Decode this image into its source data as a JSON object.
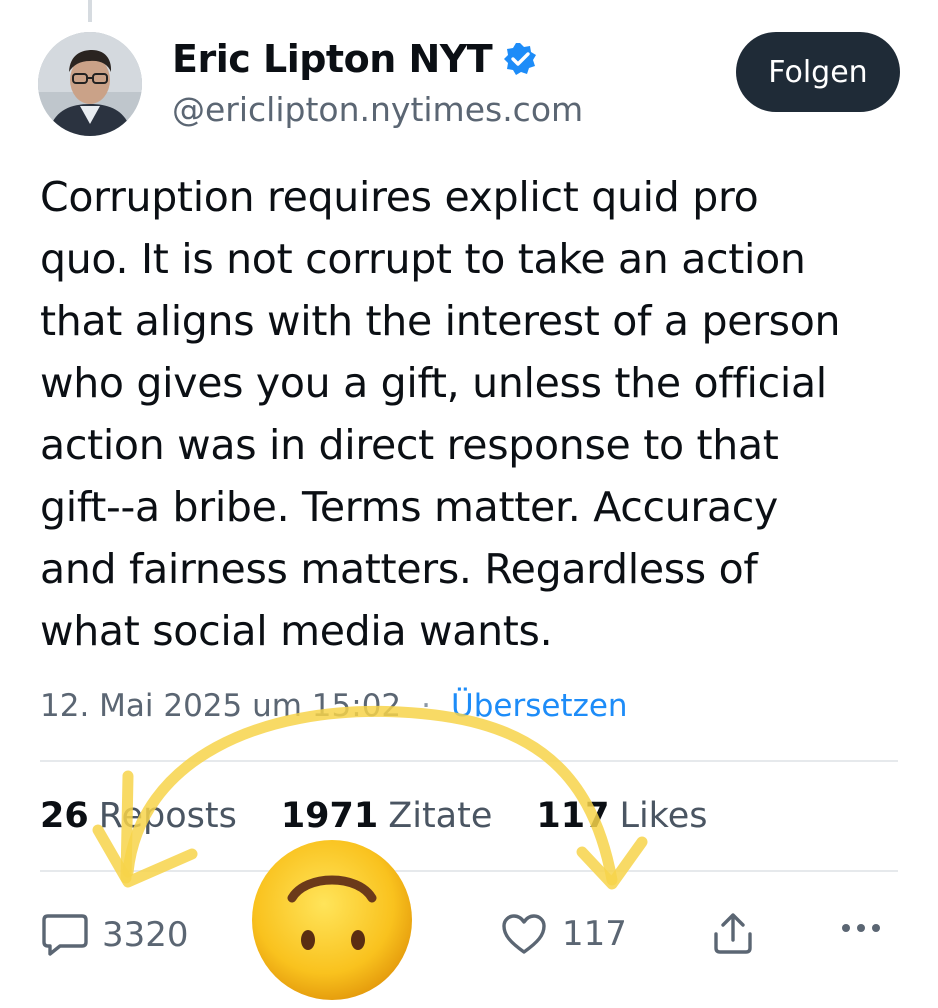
{
  "post": {
    "author": {
      "display_name": "Eric Lipton NYT",
      "handle": "@ericlipton.nytimes.com",
      "verified": true
    },
    "follow_label": "Folgen",
    "text_lines": [
      "Corruption requires explict quid pro",
      "quo. It is not corrupt to take an action",
      "that aligns with the interest of a person",
      "who gives you a gift, unless the official",
      "action was in direct response to that",
      "gift--a bribe. Terms matter. Accuracy",
      "and fairness matters. Regardless of",
      "what social media wants."
    ],
    "timestamp": "12. Mai 2025 um 15:02",
    "separator": "·",
    "translate_label": "Übersetzen",
    "stats": [
      {
        "count": "26",
        "label": "Reposts"
      },
      {
        "count": "1971",
        "label": "Zitate"
      },
      {
        "count": "117",
        "label": "Likes"
      }
    ],
    "actions": {
      "reply_count": "3320",
      "like_count": "117"
    }
  },
  "icons": {
    "verified": "verified-badge-icon",
    "reply": "speech-bubble-icon",
    "like": "heart-icon",
    "share": "share-upload-icon",
    "more": "more-dots-icon",
    "overlay_emoji": "upside-down-face-emoji"
  },
  "colors": {
    "accent": "#1d8cf8",
    "follow_bg": "#1f2b37",
    "annotation_arrow": "#f7d34a",
    "emoji": "#f9c21e"
  }
}
